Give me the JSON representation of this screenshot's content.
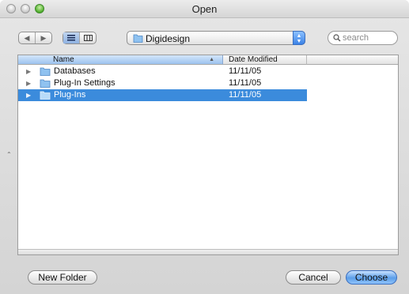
{
  "window": {
    "title": "Open"
  },
  "toolbar": {
    "back_icon": "back-arrow-icon",
    "forward_icon": "forward-arrow-icon",
    "list_view_icon": "list-view-icon",
    "column_view_icon": "column-view-icon",
    "location": "Digidesign",
    "search_placeholder": "search"
  },
  "list": {
    "columns": [
      "Name",
      "Date Modified"
    ],
    "sorted_column": "Name",
    "rows": [
      {
        "name": "Databases",
        "date": "11/11/05",
        "selected": false
      },
      {
        "name": "Plug-In Settings",
        "date": "11/11/05",
        "selected": false
      },
      {
        "name": "Plug-Ins",
        "date": "11/11/05",
        "selected": true
      }
    ]
  },
  "buttons": {
    "new_folder": "New Folder",
    "cancel": "Cancel",
    "choose": "Choose"
  },
  "colors": {
    "selection": "#3b8bdc",
    "default_button": "#5b9ee9",
    "folder": "#8fc2f0"
  }
}
